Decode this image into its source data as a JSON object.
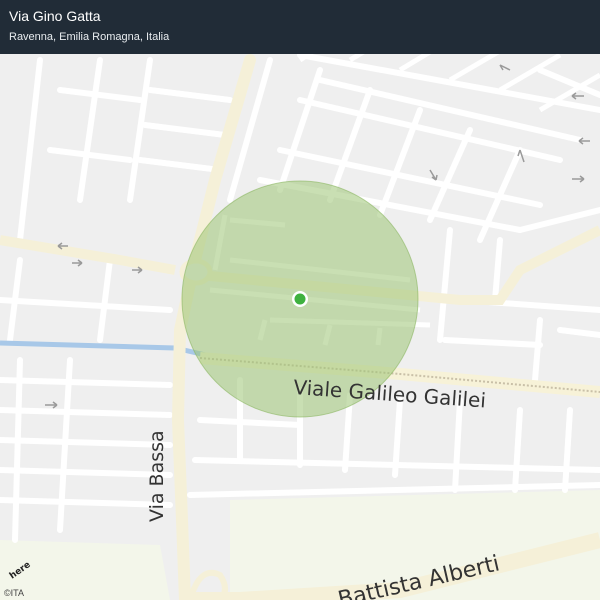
{
  "header": {
    "title": "Via Gino Gatta",
    "subtitle": "Ravenna, Emilia Romagna, Italia"
  },
  "map": {
    "streets": {
      "viale_galileo": "Viale  Galileo  Galilei",
      "via_bassa": "Via Bassa",
      "battista_alberti": "Battista  Alberti"
    },
    "location_marker": {
      "color": "#3fb13f"
    },
    "accuracy_circle": {
      "color": "#9cc574"
    }
  },
  "brand": {
    "logo": "here",
    "copyright": "©ITA"
  }
}
